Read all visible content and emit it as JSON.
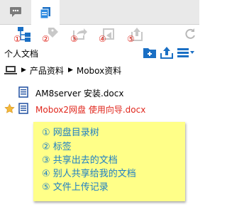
{
  "tools": {
    "num1": "①",
    "num2": "②",
    "num3": "③",
    "num4": "④",
    "num5": "⑤"
  },
  "header": {
    "title": "个人文档"
  },
  "breadcrumb": {
    "item1": "产品资料",
    "item2": "Mobox资料"
  },
  "files": [
    {
      "name": "AM8server 安装.docx"
    },
    {
      "name": "Mobox2网盘 使用向导.docx"
    }
  ],
  "note": {
    "lines": [
      "①  网盘目录树",
      "②  标签",
      "③  共享出去的文档",
      "④  别人共享给我的文档",
      "⑤  文件上传记录"
    ]
  },
  "colors": {
    "accent_blue": "#1a6fc4",
    "red": "#e0261c",
    "note_bg": "#ffff88",
    "note_text": "#1f7fc4"
  }
}
